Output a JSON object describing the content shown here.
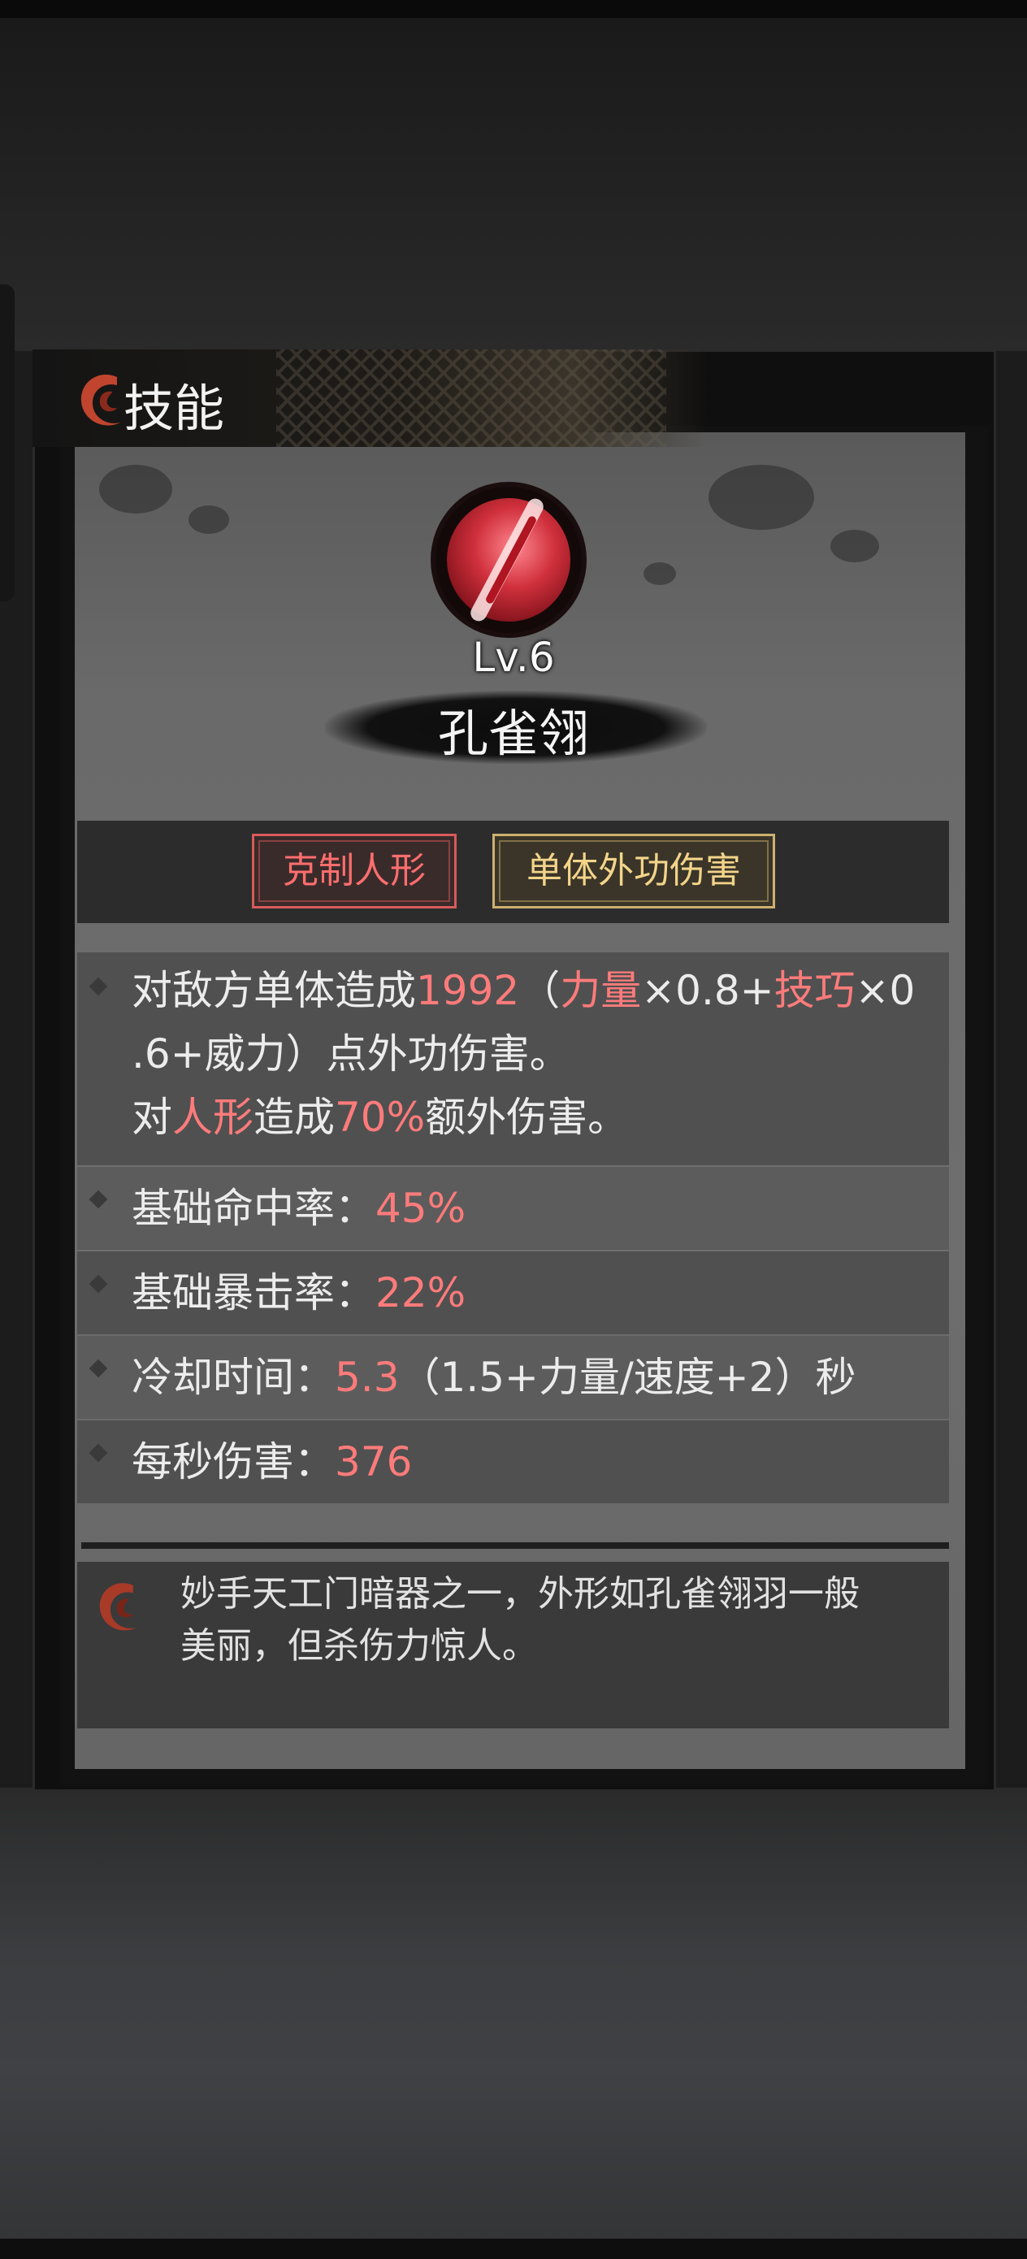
{
  "header": {
    "title": "技能"
  },
  "skill": {
    "level": "Lv.6",
    "name": "孔雀翎"
  },
  "tags": [
    "克制人形",
    "单体外功伤害"
  ],
  "effect": {
    "l1_a": "对敌方单体造成",
    "l1_b": "1992",
    "l1_c": "（",
    "l1_d": "力量",
    "l1_e": "×0.8+",
    "l1_f": "技巧",
    "l1_g": "×0",
    "l2": ".6+威力）点外功伤害。",
    "l3_a": "对",
    "l3_b": "人形",
    "l3_c": "造成",
    "l3_d": "70%",
    "l3_e": "额外伤害。"
  },
  "stats": [
    {
      "label": "基础命中率：",
      "value": "45%",
      "note": ""
    },
    {
      "label": "基础暴击率：",
      "value": "22%",
      "note": ""
    },
    {
      "label": "冷却时间：",
      "value": "5.3",
      "note": "（1.5+力量/速度+2）秒"
    },
    {
      "label": "每秒伤害：",
      "value": "376",
      "note": ""
    }
  ],
  "description": {
    "line1": "妙手天工门暗器之一，外形如孔雀翎羽一般",
    "line2": "美丽，但杀伤力惊人。"
  },
  "colors": {
    "highlight": "#ff7b7b",
    "tag_red": "#ff6e6e",
    "tag_gold": "#f3d48a",
    "logo": "#c0442e"
  },
  "icons": [
    "swirl-logo-icon",
    "peacock-feather-skill-icon",
    "diamond-bullet-icon"
  ]
}
